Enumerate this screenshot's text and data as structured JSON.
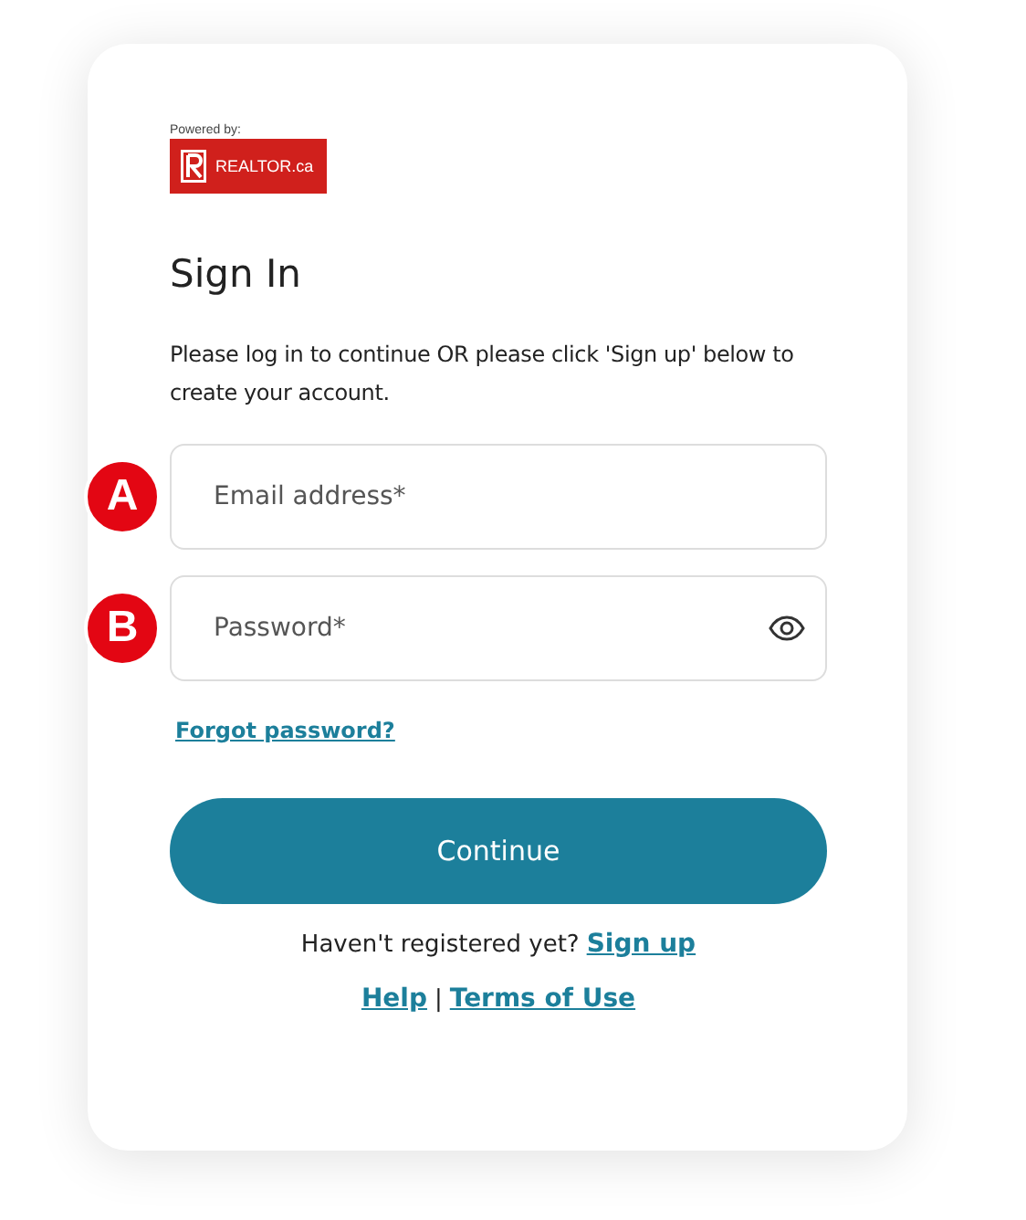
{
  "logo": {
    "caption": "Powered by:",
    "brand": "REALTOR.ca"
  },
  "title": "Sign In",
  "intro": "Please log in to continue OR please click 'Sign up' below to create your account.",
  "fields": [
    {
      "kind": "text",
      "placeholder": "Email address*",
      "marker": "A"
    },
    {
      "kind": "password",
      "placeholder": "Password*",
      "marker": "B"
    }
  ],
  "forgot_link": "Forgot password?",
  "submit": "Continue",
  "signup": {
    "prompt": "Haven't registered yet?",
    "link": "Sign up"
  },
  "footer_links": [
    {
      "label": "Help"
    },
    {
      "label": "Terms of Use"
    }
  ],
  "footer_separator": "|"
}
